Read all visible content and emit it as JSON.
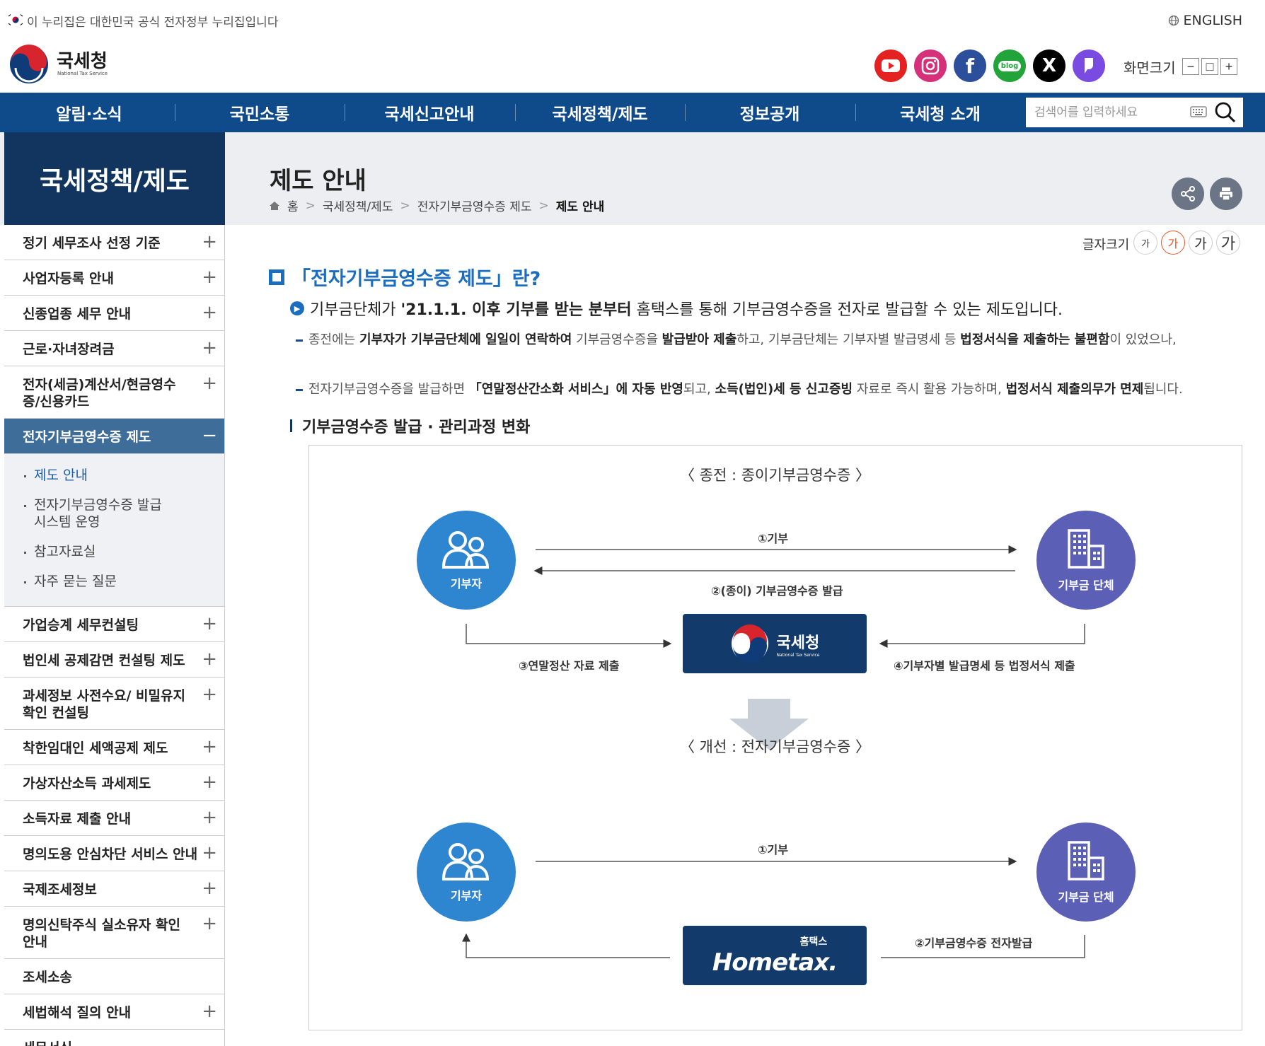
{
  "gov_banner": {
    "text": "이 누리집은 대한민국 공식 전자정부 누리집입니다",
    "english_label": "ENGLISH"
  },
  "header": {
    "logo_title": "국세청",
    "logo_subtitle": "National Tax Service",
    "sns": [
      {
        "name": "youtube",
        "color": "#e52222"
      },
      {
        "name": "instagram",
        "color": "#d6307a"
      },
      {
        "name": "facebook",
        "color": "#2b4f9a"
      },
      {
        "name": "blog",
        "label": "blog",
        "color": "#23a43a"
      },
      {
        "name": "x",
        "color": "#000000"
      },
      {
        "name": "talk",
        "color": "#7a4be0"
      }
    ],
    "screen_size_label": "화면크기",
    "zoom_out": "−",
    "zoom_reset": "□",
    "zoom_in": "+"
  },
  "gnb": {
    "items": [
      "알림·소식",
      "국민소통",
      "국세신고안내",
      "국세정책/제도",
      "정보공개",
      "국세청 소개"
    ],
    "search_placeholder": "검색어를 입력하세요"
  },
  "colors": {
    "gnb_bg": "#0f4a8a",
    "lnb_title_bg": "#11355e",
    "lnb_active_bg": "#3e6d99",
    "accent_blue": "#1b6dbf",
    "circle_blue": "#2f86d0",
    "circle_purple": "#5b5fb5",
    "nts_box": "#123a6a"
  },
  "lnb": {
    "title": "국세정책/제도",
    "items_top": [
      "정기 세무조사 선정 기준",
      "사업자등록 안내",
      "신종업종 세무 안내",
      "근로·자녀장려금",
      "전자(세금)계산서/현금영수증/신용카드"
    ],
    "active_item": "전자기부금영수증 제도",
    "sub_items": [
      "제도 안내",
      "전자기부금영수증 발급 시스템 운영",
      "참고자료실",
      "자주 묻는 질문"
    ],
    "items_bottom": [
      "가업승계 세무컨설팅",
      "법인세 공제감면 컨설팅 제도",
      "과세정보 사전수요/ 비밀유지 확인 컨설팅",
      "착한임대인 세액공제 제도",
      "가상자산소득 과세제도",
      "소득자료 제출 안내",
      "명의도용 안심차단 서비스 안내",
      "국제조세정보",
      "명의신탁주식 실소유자 확인안내",
      "조세소송",
      "세법해석 질의 안내",
      "세무서식"
    ]
  },
  "page": {
    "title": "제도 안내",
    "breadcrumb": [
      "홈",
      "국세정책/제도",
      "전자기부금영수증 제도",
      "제도 안내"
    ],
    "font_size_label": "글자크기",
    "font_sizes": [
      "가",
      "가",
      "가",
      "가"
    ]
  },
  "content": {
    "heading": "「전자기부금영수증 제도」란?",
    "summary_pre": "기부금단체가 ",
    "summary_bold": "'21.1.1. 이후 기부를 받는 분부터",
    "summary_post": " 홈택스를 통해 기부금영수증을 전자로 발급할 수 있는 제도입니다.",
    "detail1": {
      "t1": "종전에는 ",
      "b1": "기부자가 기부금단체에 일일이 연락하여",
      "t2": " 기부금영수증을 ",
      "b2": "발급받아 제출",
      "t3": "하고, 기부금단체는 기부자별 발급명세 등 ",
      "b3": "법정서식을 제출하는 불편함",
      "t4": "이 있었으나,"
    },
    "detail2": {
      "t1": "전자기부금영수증을 발급하면 ",
      "b1": "「연말정산간소화 서비스」에 자동 반영",
      "t2": "되고, ",
      "b2": "소득(법인)세 등 신고증빙",
      "t3": " 자료로 즉시 활용 가능하며, ",
      "b3": "법정서식 제출의무가 면제",
      "t4": "됩니다."
    },
    "subheading": "기부금영수증 발급 · 관리과정 변화"
  },
  "diagram": {
    "before_title": "〈 종전 : 종이기부금영수증 〉",
    "after_title": "〈 개선 : 전자기부금영수증 〉",
    "donor": "기부자",
    "org": "기부금 단체",
    "before_steps": [
      "①기부",
      "②(종이) 기부금영수증 발급",
      "③연말정산 자료 제출",
      "④기부자별 발급명세 등 법정서식 제출"
    ],
    "after_steps": [
      "①기부",
      "②기부금영수증 전자발급"
    ],
    "nts_title": "국세청",
    "nts_sub": "National Tax Service",
    "hometax_small": "홈택스",
    "hometax_logo": "Hometax."
  }
}
